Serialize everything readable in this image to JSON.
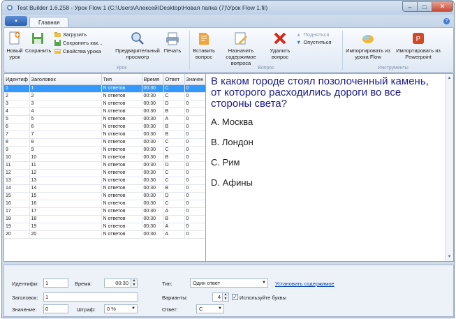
{
  "window": {
    "title": "Test Builder 1.6.258 - Урок Flow 1 (C:\\Users\\Алексей\\Desktop\\Новая папка (7)\\Урок Flow 1.fil)",
    "min": "–",
    "max": "□",
    "close": "✕"
  },
  "ribbon_tabs": {
    "app_button": "▾",
    "home": "Главная",
    "help": "?"
  },
  "ribbon": {
    "new_lesson": "Новый урок",
    "save": "Сохранить",
    "load": "Загрузить",
    "save_as": "Сохранить как...",
    "lesson_props": "Свойства урока",
    "preview": "Предварительный просмотр",
    "print": "Печать",
    "group_lesson": "Урок",
    "insert_question": "Вставить вопрос",
    "assign_content": "Назначить содержимое вопроса",
    "delete_question": "Удалить вопрос",
    "move_up": "Подняться",
    "move_down": "Опуститься",
    "group_question": "Вопрос",
    "import_flow": "Импортировать из урока Flow",
    "import_ppt": "Импортировать из Powerpoint",
    "group_tools": "Инструменты"
  },
  "grid": {
    "headers": [
      "Идентиф",
      "Заголовок",
      "Тип",
      "Время",
      "Ответ",
      "Значен"
    ],
    "rows": [
      [
        "1",
        "1",
        "N ответов",
        "00:30",
        "C",
        "0"
      ],
      [
        "2",
        "2",
        "N ответов",
        "00:30",
        "C",
        "0"
      ],
      [
        "3",
        "3",
        "N ответов",
        "00:30",
        "D",
        "0"
      ],
      [
        "4",
        "4",
        "N ответов",
        "00:30",
        "B",
        "0"
      ],
      [
        "5",
        "5",
        "N ответов",
        "00:30",
        "A",
        "0"
      ],
      [
        "6",
        "6",
        "N ответов",
        "00:30",
        "B",
        "0"
      ],
      [
        "7",
        "7",
        "N ответов",
        "00:30",
        "B",
        "0"
      ],
      [
        "8",
        "8",
        "N ответов",
        "00:30",
        "C",
        "0"
      ],
      [
        "9",
        "9",
        "N ответов",
        "00:30",
        "C",
        "0"
      ],
      [
        "10",
        "10",
        "N ответов",
        "00:30",
        "B",
        "0"
      ],
      [
        "11",
        "11",
        "N ответов",
        "00:30",
        "D",
        "0"
      ],
      [
        "12",
        "12",
        "N ответов",
        "00:30",
        "C",
        "0"
      ],
      [
        "13",
        "13",
        "N ответов",
        "00:30",
        "C",
        "0"
      ],
      [
        "14",
        "14",
        "N ответов",
        "00:30",
        "B",
        "0"
      ],
      [
        "15",
        "15",
        "N ответов",
        "00:30",
        "D",
        "0"
      ],
      [
        "16",
        "16",
        "N ответов",
        "00:30",
        "C",
        "0"
      ],
      [
        "17",
        "17",
        "N ответов",
        "00:30",
        "A",
        "0"
      ],
      [
        "18",
        "18",
        "N ответов",
        "00:30",
        "B",
        "0"
      ],
      [
        "19",
        "19",
        "N ответов",
        "00:30",
        "A",
        "0"
      ],
      [
        "20",
        "20",
        "N ответов",
        "00:30",
        "A",
        "0"
      ]
    ]
  },
  "question": {
    "text": "В каком городе стоял позолоченный камень, от которого расходились дороги во все стороны света?",
    "answers": [
      "A. Москва",
      "B. Лондон",
      "C. Рим",
      "D. Афины"
    ]
  },
  "props": {
    "id_label": "Идентифи:",
    "id_value": "1",
    "time_label": "Время:",
    "time_value": "00:30",
    "title_label": "Заголовок:",
    "title_value": "1",
    "value_label": "Значение:",
    "value_value": "0",
    "penalty_label": "Штраф:",
    "penalty_value": "0 %",
    "type_label": "Тип:",
    "type_value": "Один ответ",
    "set_content": "Установить содержимое",
    "variants_label": "Варианты:",
    "variants_value": "4",
    "use_letters": "Используйте буквы",
    "answer_label": "Ответ:",
    "answer_value": "C"
  },
  "colors": {
    "selection": "#3399ff",
    "question_text": "#1c1c8c"
  }
}
